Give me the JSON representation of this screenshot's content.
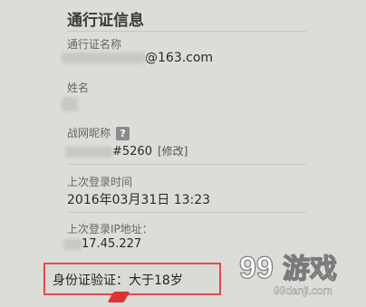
{
  "section_title": "通行证信息",
  "passport_name": {
    "label": "通行证名称",
    "value": "@163.com"
  },
  "name": {
    "label": "姓名"
  },
  "nickname": {
    "label": "战网昵称",
    "help_icon": "?",
    "value_suffix": "#5260",
    "edit_label": "[修改]"
  },
  "last_login_time": {
    "label": "上次登录时间",
    "value": "2016年03月31日 13:23"
  },
  "last_login_ip": {
    "label": "上次登录IP地址：",
    "value": "17.45.227"
  },
  "id_verification": {
    "text": "身份证验证：大于18岁",
    "highlight_color": "#e04a4a"
  },
  "watermark": {
    "brand_text": "游戏",
    "logo_text": "99",
    "url_text": "99danji.com"
  }
}
